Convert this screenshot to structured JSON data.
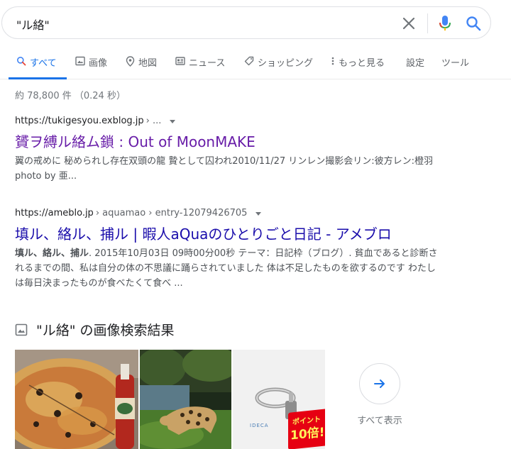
{
  "search": {
    "query": "\"ル絡\""
  },
  "tabs": [
    {
      "label": "すべて",
      "icon": "search-icon",
      "active": true
    },
    {
      "label": "画像",
      "icon": "image-icon"
    },
    {
      "label": "地図",
      "icon": "map-pin-icon"
    },
    {
      "label": "ニュース",
      "icon": "news-icon"
    },
    {
      "label": "ショッピング",
      "icon": "tag-icon"
    },
    {
      "label": "もっと見る",
      "icon": "more-vert-icon"
    },
    {
      "label": "設定"
    },
    {
      "label": "ツール"
    }
  ],
  "stats": "約 78,800 件 （0.24 秒）",
  "results": [
    {
      "domain": "https://tukigesyou.exblog.jp",
      "path": " › ...",
      "title": "贇ヲ縛ル絡ム鎖 : Out of MoonMAKE",
      "snippet": "翼の戒めに 秘められし存在双頭の龍 贄として囚われ2010/11/27 リンレン撮影会リン:彼方レン:橙羽photo by 亜..."
    },
    {
      "domain": "https://ameblo.jp",
      "path": " › aquamao › entry-12079426705",
      "title": "填ル、絡ル、捕ル | 暇人aQuaのひとりごと日記 - アメブロ",
      "snippet_bold": "填ル、絡ル、捕ル",
      "snippet": ". 2015年10月03日 09時00分00秒 テーマ：日記枠（ブログ）. 貧血であると診断されるまでの間、私は自分の体の不思議に踊らされていました 体は不足したものを欲するのです わたしは毎日決まったものが食べたくて食べ ..."
    }
  ],
  "images_section": {
    "heading": "\"ル絡\" の画像検索結果",
    "thumb_badge_brand": "IDECA",
    "thumb_badge_line1": "ポイント",
    "thumb_badge_line2": "10倍!",
    "more_label": "すべて表示"
  },
  "colors": {
    "accent": "#1a73e8",
    "visited_link": "#681da8",
    "link": "#1a0dab",
    "badge_red": "#e60012"
  }
}
